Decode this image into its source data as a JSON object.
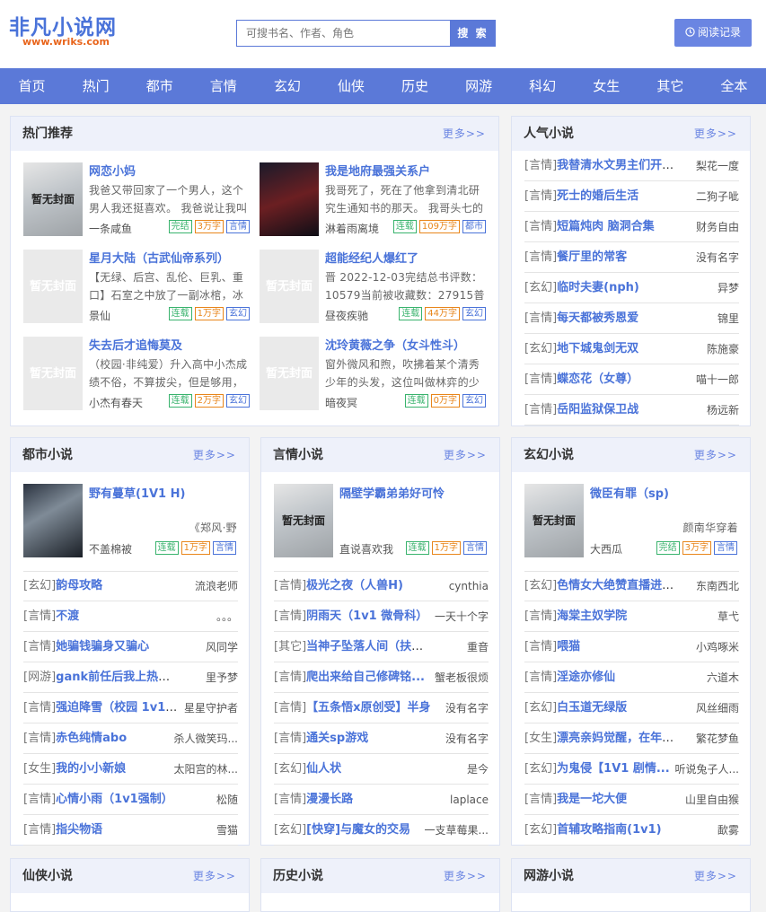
{
  "header": {
    "logo_title": "非凡小说网",
    "logo_url": "www.wriks.com",
    "search_placeholder": "可搜书名、作者、角色",
    "search_button": "搜 索",
    "history_button": "阅读记录"
  },
  "nav": [
    "首页",
    "热门",
    "都市",
    "言情",
    "玄幻",
    "仙侠",
    "历史",
    "网游",
    "科幻",
    "女生",
    "其它",
    "全本"
  ],
  "more_label": "更多>>",
  "no_cover": "暂无封面",
  "hot": {
    "title": "热门推荐",
    "books": [
      {
        "title": "网恋小妈",
        "desc": "我爸又带回家了一个男人，这个男人我还挺喜欢。 我爸说让我叫",
        "author": "一条咸鱼",
        "tags": [
          "完结",
          "3万字",
          "言情"
        ],
        "cover": "real"
      },
      {
        "title": "我是地府最强关系户",
        "desc": "我哥死了，死在了他拿到清北研究生通知书的那天。 我哥头七的",
        "author": "淋着雨离境",
        "tags": [
          "连载",
          "109万字",
          "都市"
        ],
        "cover": "img2"
      },
      {
        "title": "星月大陆（古武仙帝系列）",
        "desc": "【无绿、后宫、乱伦、巨乳、重口】石室之中放了一副冰棺，冰",
        "author": "景仙",
        "tags": [
          "连载",
          "1万字",
          "玄幻"
        ],
        "cover": "none"
      },
      {
        "title": "超能经纪人爆红了",
        "desc": "晋 2022-12-03完结总书评数：10579当前被收藏数：27915普养",
        "author": "昼夜疾驰",
        "tags": [
          "连载",
          "44万字",
          "玄幻"
        ],
        "cover": "none"
      },
      {
        "title": "失去后才追悔莫及",
        "desc": "（校园·非纯爱）升入高中小杰成绩不俗，不算拔尖，但是够用，",
        "author": "小杰有春天",
        "tags": [
          "连载",
          "2万字",
          "玄幻"
        ],
        "cover": "none"
      },
      {
        "title": "沈玲黄薇之争（女斗性斗）",
        "desc": "窗外微风和煦，吹拂着某个清秀少年的头发，这位叫做林弈的少",
        "author": "暗夜冥",
        "tags": [
          "连载",
          "0万字",
          "玄幻"
        ],
        "cover": "none"
      }
    ]
  },
  "popular": {
    "title": "人气小说",
    "rows": [
      {
        "cat": "[言情]",
        "title": "我替清水文男主们开辛...",
        "author": "梨花一度"
      },
      {
        "cat": "[言情]",
        "title": "死士的婚后生活",
        "author": "二狗子呲"
      },
      {
        "cat": "[言情]",
        "title": "短篇炖肉 脑洞合集",
        "author": "财务自由"
      },
      {
        "cat": "[言情]",
        "title": "餐厅里的常客",
        "author": "没有名字"
      },
      {
        "cat": "[玄幻]",
        "title": "临时夫妻(nph)",
        "author": "异梦"
      },
      {
        "cat": "[言情]",
        "title": "每天都被秀恩爱",
        "author": "锦里"
      },
      {
        "cat": "[玄幻]",
        "title": "地下城鬼剑无双",
        "author": "陈施豪"
      },
      {
        "cat": "[言情]",
        "title": "蝶恋花（女尊）",
        "author": "喵十一郎"
      },
      {
        "cat": "[言情]",
        "title": "岳阳监狱保卫战",
        "author": "杨远新"
      }
    ]
  },
  "sections": [
    {
      "title": "都市小说",
      "feat": {
        "title": "野有蔓草(1V1 H)",
        "desc": "《郑风·野",
        "author": "不盖棉被",
        "tags": [
          "连载",
          "1万字",
          "言情"
        ],
        "cover": "img3"
      },
      "rows": [
        {
          "cat": "[玄幻]",
          "title": "韵母攻略",
          "author": "流浪老师"
        },
        {
          "cat": "[言情]",
          "title": "不渡",
          "author": "。。。"
        },
        {
          "cat": "[言情]",
          "title": "她骗钱骗身又骗心",
          "author": "风同学"
        },
        {
          "cat": "[网游]",
          "title": "gank前任后我上热搜了[...",
          "author": "里予梦"
        },
        {
          "cat": "[言情]",
          "title": "强迫降雪（校园 1v1 ...",
          "author": "星星守护者"
        },
        {
          "cat": "[言情]",
          "title": "赤色纯情abo",
          "author": "杀人微笑玛..."
        },
        {
          "cat": "[女生]",
          "title": "我的小小新娘",
          "author": "太阳宫的林..."
        },
        {
          "cat": "[言情]",
          "title": "心情小雨（1v1强制）",
          "author": "松随"
        },
        {
          "cat": "[言情]",
          "title": "指尖物语",
          "author": "雪猫"
        }
      ]
    },
    {
      "title": "言情小说",
      "feat": {
        "title": "隔壁学霸弟弟好可怜",
        "desc": "",
        "author": "直说喜欢我",
        "tags": [
          "连载",
          "1万字",
          "言情"
        ],
        "cover": "real"
      },
      "rows": [
        {
          "cat": "[言情]",
          "title": "极光之夜（人兽H)",
          "author": "cynthia"
        },
        {
          "cat": "[言情]",
          "title": "阴雨天（1v1 微骨科）",
          "author": "一天十个字"
        },
        {
          "cat": "[其它]",
          "title": "当神子坠落人间（扶她）",
          "author": "重音"
        },
        {
          "cat": "[言情]",
          "title": "爬出来给自己修碑铭...",
          "author": "蟹老板很烦"
        },
        {
          "cat": "[言情]",
          "title": "【五条悟x原创受】半身",
          "author": "没有名字"
        },
        {
          "cat": "[言情]",
          "title": "通关sp游戏",
          "author": "没有名字"
        },
        {
          "cat": "[玄幻]",
          "title": "仙人状",
          "author": "是今"
        },
        {
          "cat": "[言情]",
          "title": "漫漫长路",
          "author": "laplace"
        },
        {
          "cat": "[玄幻]",
          "title": "[快穿]与魔女的交易",
          "author": "一支草莓果..."
        }
      ]
    },
    {
      "title": "玄幻小说",
      "feat": {
        "title": "微臣有罪（sp)",
        "desc": "颜南华穿着",
        "author": "大西瓜",
        "tags": [
          "完结",
          "3万字",
          "言情"
        ],
        "cover": "real"
      },
      "rows": [
        {
          "cat": "[玄幻]",
          "title": "色情女大绝赞直播进行...",
          "author": "东南西北"
        },
        {
          "cat": "[言情]",
          "title": "海棠主奴学院",
          "author": "草弋"
        },
        {
          "cat": "[言情]",
          "title": "喂猫",
          "author": "小鸡啄米"
        },
        {
          "cat": "[言情]",
          "title": "淫途亦修仙",
          "author": "六道木"
        },
        {
          "cat": "[玄幻]",
          "title": "白玉道无绿版",
          "author": "风丝细雨"
        },
        {
          "cat": "[女生]",
          "title": "漂亮亲妈觉醒，在年代...",
          "author": "繁花梦鱼"
        },
        {
          "cat": "[玄幻]",
          "title": "为鬼侵【1V1 剧情...",
          "author": "听说兔子人..."
        },
        {
          "cat": "[言情]",
          "title": "我是一坨大便",
          "author": "山里自由猴"
        },
        {
          "cat": "[玄幻]",
          "title": "首辅攻略指南(1v1)",
          "author": "歃雾"
        }
      ]
    }
  ],
  "bottom_sections": [
    "仙侠小说",
    "历史小说",
    "网游小说"
  ]
}
